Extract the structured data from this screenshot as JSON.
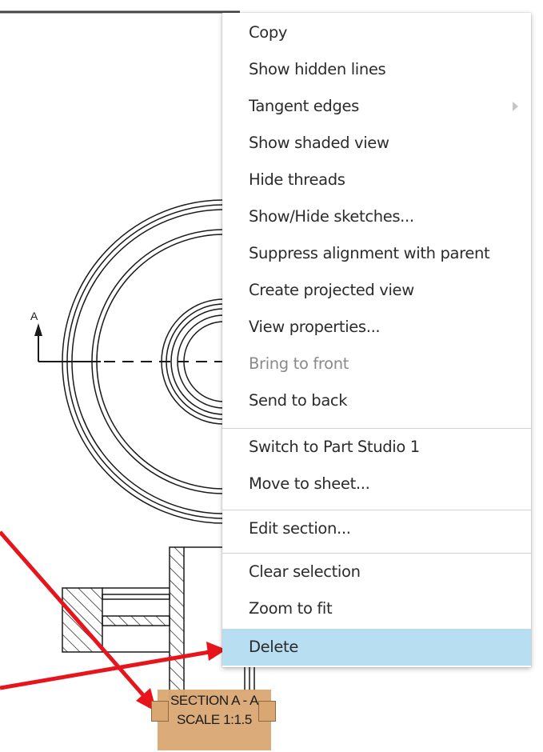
{
  "context_menu": {
    "items": [
      {
        "label": "Copy",
        "enabled": true
      },
      {
        "label": "Show hidden lines",
        "enabled": true
      },
      {
        "label": "Tangent edges",
        "enabled": true,
        "has_submenu": true
      },
      {
        "label": "Show shaded view",
        "enabled": true
      },
      {
        "label": "Hide threads",
        "enabled": true
      },
      {
        "label": "Show/Hide sketches...",
        "enabled": true
      },
      {
        "label": "Suppress alignment with parent",
        "enabled": true
      },
      {
        "label": "Create projected view",
        "enabled": true
      },
      {
        "label": "View properties...",
        "enabled": true
      },
      {
        "label": "Bring to front",
        "enabled": false
      },
      {
        "label": "Send to back",
        "enabled": true
      },
      {
        "label": "Switch to Part Studio 1",
        "enabled": true
      },
      {
        "label": "Move to sheet...",
        "enabled": true
      },
      {
        "label": "Edit section...",
        "enabled": true
      },
      {
        "label": "Clear selection",
        "enabled": true
      },
      {
        "label": "Zoom to fit",
        "enabled": true
      },
      {
        "label": "Delete",
        "enabled": true,
        "highlighted": true
      }
    ]
  },
  "drawing": {
    "section_marker": "A",
    "view_label": {
      "line1": "SECTION A - A",
      "line2": "SCALE 1:1.5"
    }
  },
  "colors": {
    "highlight": "#b8def2",
    "annotation_arrow": "#e8141b",
    "label_fill": "#d9a772",
    "disabled_text": "#8a8a8a"
  }
}
